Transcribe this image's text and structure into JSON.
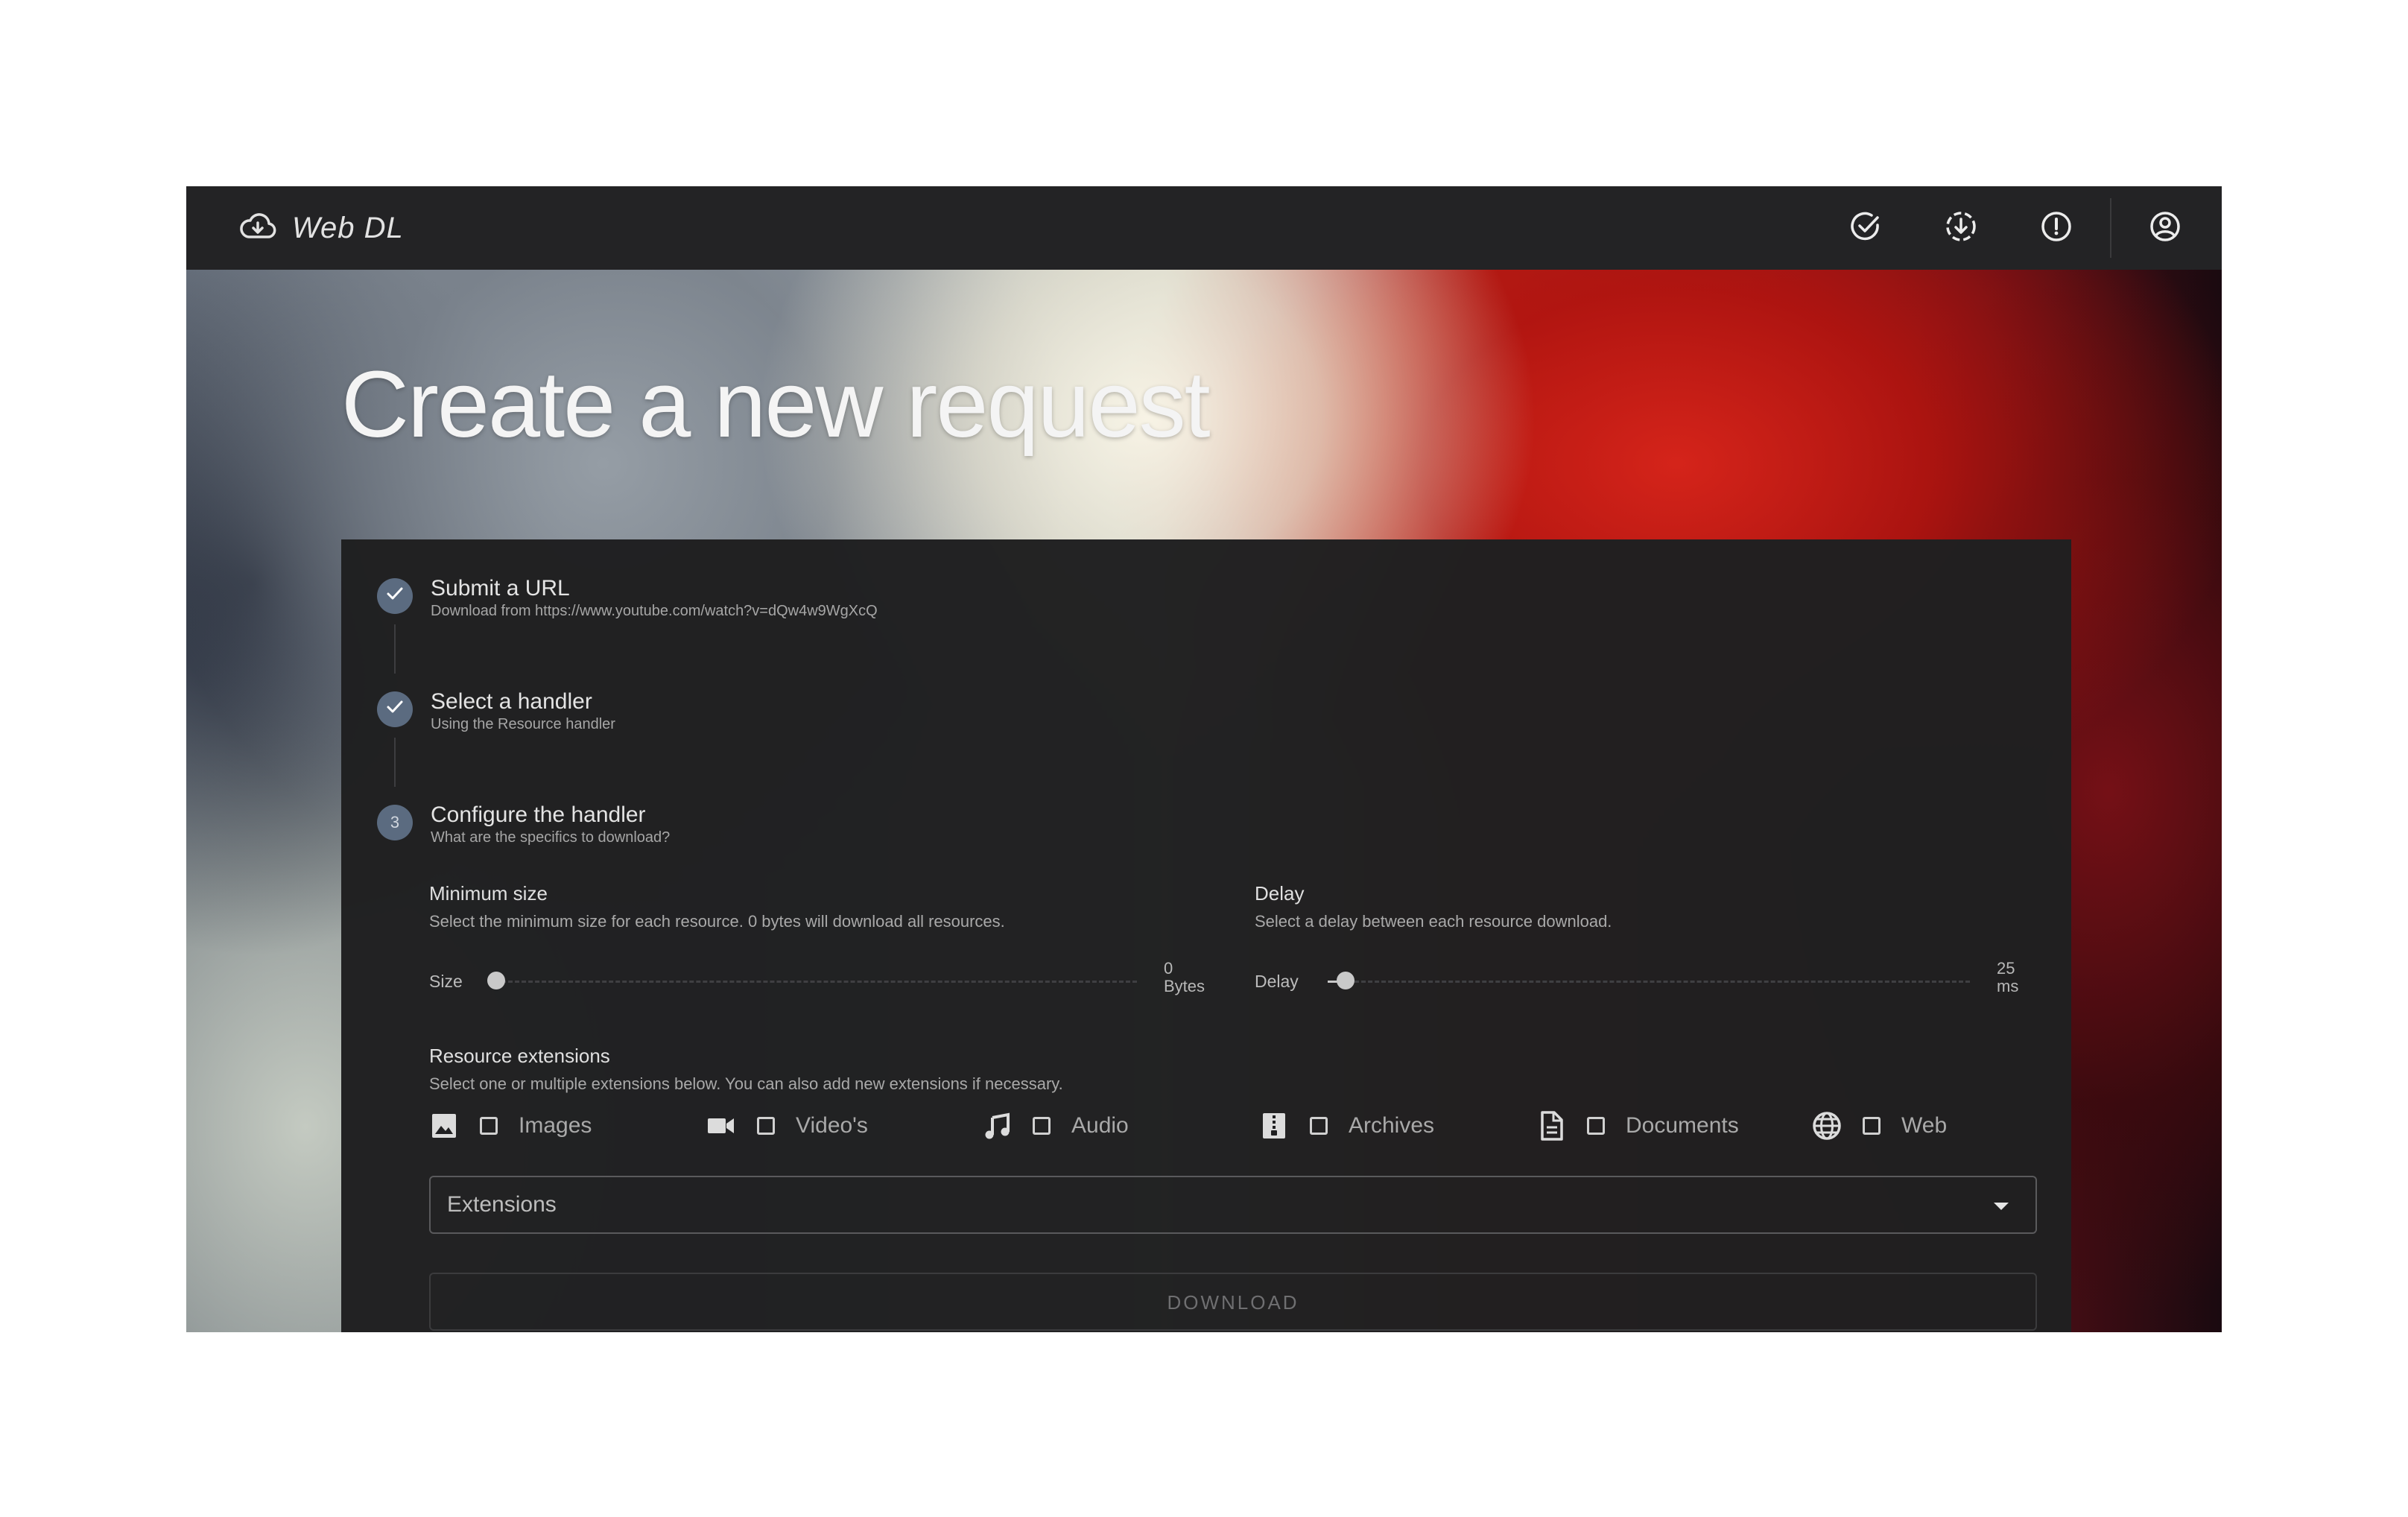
{
  "app": {
    "name": "Web DL",
    "accent_color": "#5b6b80",
    "nav_icons": [
      "check-circle-icon",
      "download-circle-icon",
      "alert-circle-icon",
      "account-circle-icon"
    ]
  },
  "hero": {
    "title": "Create a new request"
  },
  "stepper": {
    "steps": [
      {
        "title": "Submit a URL",
        "subtitle": "Download from https://www.youtube.com/watch?v=dQw4w9WgXcQ",
        "status": "completed"
      },
      {
        "title": "Select a handler",
        "subtitle": "Using the Resource handler",
        "status": "completed"
      },
      {
        "number": "3",
        "title": "Configure the handler",
        "subtitle": "What are the specifics to download?",
        "status": "active"
      }
    ]
  },
  "config": {
    "min_size": {
      "label": "Minimum size",
      "help": "Select the minimum size for each resource. 0 bytes will download all resources.",
      "slider_label": "Size",
      "value": "0",
      "unit": "Bytes",
      "fraction": 0.0
    },
    "delay": {
      "label": "Delay",
      "help": "Select a delay between each resource download.",
      "slider_label": "Delay",
      "value": "25",
      "unit": "ms",
      "fraction": 0.025
    },
    "extensions": {
      "label": "Resource extensions",
      "help": "Select one or multiple extensions below. You can also add new extensions if necessary.",
      "options": [
        {
          "label": "Images",
          "icon": "image-icon",
          "checked": false
        },
        {
          "label": "Video's",
          "icon": "video-camera-icon",
          "checked": false
        },
        {
          "label": "Audio",
          "icon": "music-note-icon",
          "checked": false
        },
        {
          "label": "Archives",
          "icon": "archive-zip-icon",
          "checked": false
        },
        {
          "label": "Documents",
          "icon": "document-icon",
          "checked": false
        },
        {
          "label": "Web",
          "icon": "globe-icon",
          "checked": false
        }
      ],
      "select_placeholder": "Extensions"
    },
    "download_label": "DOWNLOAD"
  }
}
